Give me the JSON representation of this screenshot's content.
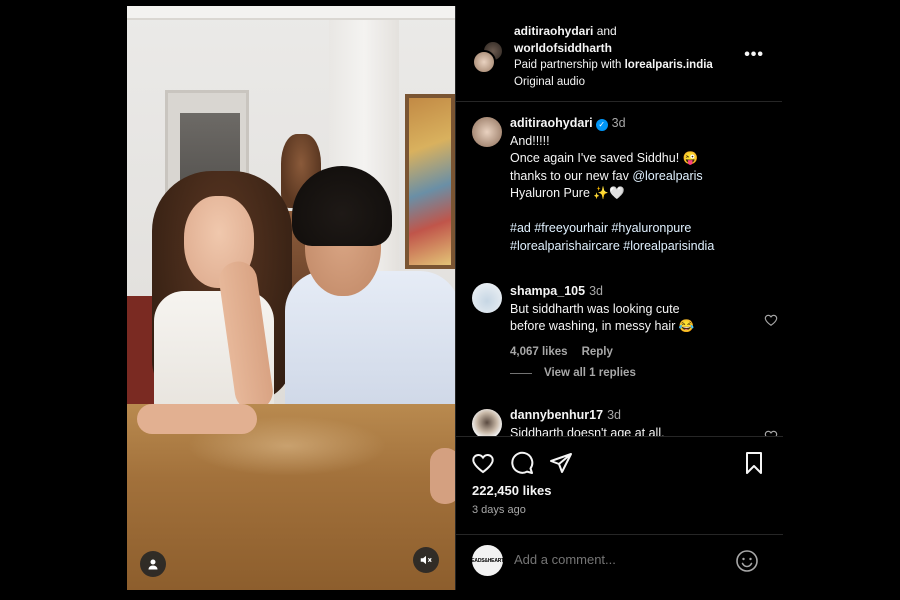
{
  "post": {
    "author1": "aditiraohydari",
    "and_word": "and",
    "author2": "worldofsiddharth",
    "partnership_prefix": "Paid partnership with",
    "partner": "lorealparis.india",
    "audio": "Original audio",
    "more_label": "•••"
  },
  "caption": {
    "username": "aditiraohydari",
    "time": "3d",
    "line1": "And!!!!!",
    "line2": "Once again I've saved Siddhu! 😜",
    "line3_prefix": "thanks to our new fav",
    "mention": "@lorealparis",
    "line4": "Hyaluron Pure ✨🤍",
    "hashtags1": "#ad #freeyourhair #hyaluronpure",
    "hashtags2": "#lorealparishaircare #lorealparisindia"
  },
  "comments": [
    {
      "username": "shampa_105",
      "time": "3d",
      "text1": "But siddharth was looking cute",
      "text2": "before washing, in messy hair 😂",
      "likes": "4,067 likes",
      "reply": "Reply"
    },
    {
      "username": "dannybenhur17",
      "time": "3d",
      "text1": "Siddharth doesn't age at all."
    }
  ],
  "view_replies": "View all 1 replies",
  "stats": {
    "likes": "222,450 likes",
    "ago": "3 days ago"
  },
  "add_comment": {
    "placeholder": "Add a comment...",
    "avatar_text": "HEADS&HEARTS"
  },
  "colors": {
    "background": "#000000",
    "border": "#262626",
    "muted": "#a8a8a8",
    "verified": "#0095f6",
    "link": "#e0f1ff"
  }
}
